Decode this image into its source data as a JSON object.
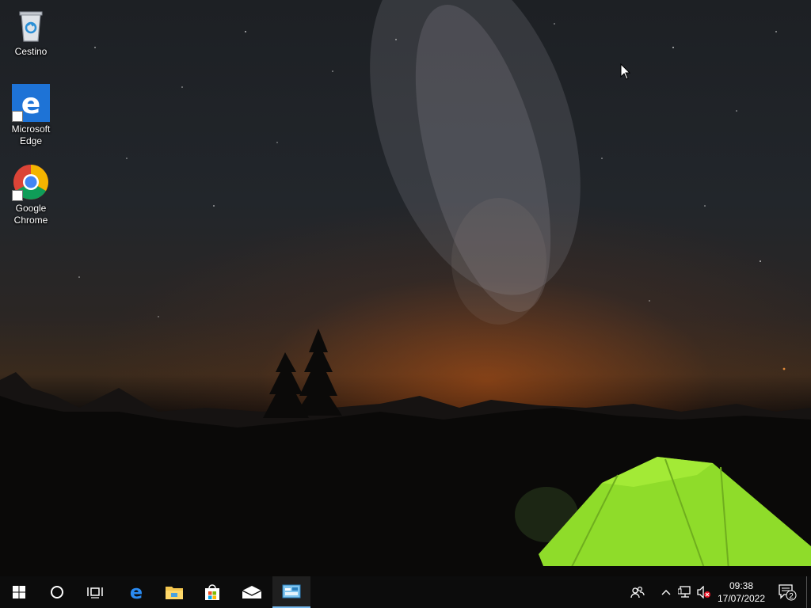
{
  "desktop": {
    "icons": [
      {
        "label_line1": "Cestino",
        "label_line2": "",
        "icon": "recycle-bin-icon"
      },
      {
        "label_line1": "Microsoft",
        "label_line2": "Edge",
        "icon": "edge-icon"
      },
      {
        "label_line1": "Google",
        "label_line2": "Chrome",
        "icon": "chrome-icon"
      }
    ]
  },
  "taskbar": {
    "pinned": [
      {
        "name": "start-button",
        "icon": "windows-logo-icon"
      },
      {
        "name": "cortana-search-button",
        "icon": "circle-icon"
      },
      {
        "name": "task-view-button",
        "icon": "task-view-icon"
      },
      {
        "name": "edge-taskbar-button",
        "icon": "edge-icon"
      },
      {
        "name": "file-explorer-taskbar-button",
        "icon": "folder-icon"
      },
      {
        "name": "store-taskbar-button",
        "icon": "store-bag-icon"
      },
      {
        "name": "mail-taskbar-button",
        "icon": "mail-icon"
      },
      {
        "name": "control-panel-taskbar-button",
        "icon": "control-panel-icon"
      }
    ],
    "tray": {
      "time": "09:38",
      "date": "17/07/2022",
      "notification_count": "2"
    }
  },
  "colors": {
    "taskbar_bg": "#0c0c0c",
    "accent": "#76b9ed",
    "tent_green": "#8fdc2a"
  }
}
